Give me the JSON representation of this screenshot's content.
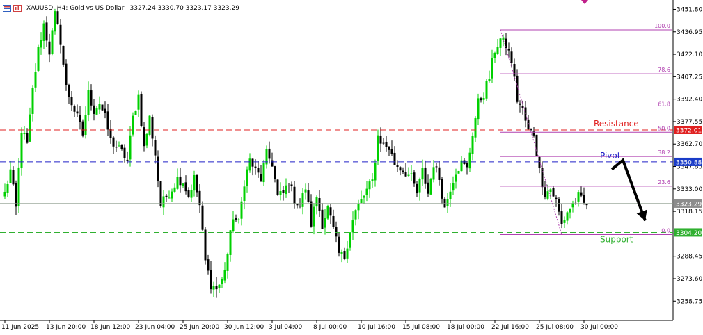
{
  "header": {
    "symbol_line": "XAUUSD, H4:  Gold vs US Dollar",
    "ohlc": "3327.24 3330.70 3323.17 3323.29",
    "icons": [
      "chart-list-icon",
      "chart-bars-icon"
    ]
  },
  "colors": {
    "bull": "#00d000",
    "bear": "#000000",
    "grid": "#ffffff",
    "axis": "#000000",
    "resistance": "#e02020",
    "pivot": "#2020c8",
    "support": "#30b030",
    "fib": "#b040b0",
    "current_line": "#8a9a8a",
    "current_tag": "#8c8c8c",
    "marker": "#c0208a"
  },
  "chart_data": {
    "type": "candlestick",
    "title": "XAUUSD, H4: Gold vs US Dollar",
    "ylim": [
      3246,
      3458
    ],
    "y_ticks": [
      "3451.80",
      "3436.95",
      "3422.10",
      "3407.25",
      "3392.40",
      "3377.55",
      "3362.70",
      "3347.85",
      "3333.00",
      "3318.15",
      "3303.30",
      "3288.45",
      "3273.60",
      "3258.75"
    ],
    "y_tick_values": [
      3451.8,
      3436.95,
      3422.1,
      3407.25,
      3392.4,
      3377.55,
      3362.7,
      3347.85,
      3333.0,
      3318.15,
      3303.3,
      3288.45,
      3273.6,
      3258.75
    ],
    "x_ticks": [
      "11 Jun 2025",
      "13 Jun 20:00",
      "18 Jun 12:00",
      "23 Jun 04:00",
      "25 Jun 20:00",
      "30 Jun 12:00",
      "3 Jul 04:00",
      "8 Jul 00:00",
      "10 Jul 16:00",
      "15 Jul 08:00",
      "18 Jul 00:00",
      "22 Jul 16:00",
      "25 Jul 08:00",
      "30 Jul 00:00"
    ],
    "x_tick_index": [
      0,
      16,
      32,
      48,
      64,
      80,
      96,
      112,
      128,
      144,
      160,
      176,
      192,
      208
    ],
    "levels": [
      {
        "name": "Resistance",
        "value": 3372.01,
        "label": "3372.01"
      },
      {
        "name": "Pivot",
        "value": 3350.88,
        "label": "3350.88"
      },
      {
        "name": "Support",
        "value": 3304.2,
        "label": "3304.20"
      }
    ],
    "current_price": {
      "value": 3323.29,
      "label": "3323.29"
    },
    "fibonacci": {
      "high": 3438.2,
      "low": 3302.8,
      "start_index": 178,
      "end_index": 200,
      "levels": [
        {
          "label": "100.0",
          "value": 3438.2
        },
        {
          "label": "78.6",
          "value": 3409.2
        },
        {
          "label": "61.8",
          "value": 3386.5
        },
        {
          "label": "50.0",
          "value": 3370.5
        },
        {
          "label": "38.2",
          "value": 3354.5
        },
        {
          "label": "23.6",
          "value": 3334.8
        },
        {
          "label": "0.0",
          "value": 3302.8
        }
      ]
    },
    "annotations": [
      {
        "text": "Resistance",
        "color": "resistance"
      },
      {
        "text": "Pivot",
        "color": "pivot"
      },
      {
        "text": "Support",
        "color": "support"
      }
    ],
    "arrow_path": [
      [
        218,
        3346
      ],
      [
        222,
        3352
      ],
      [
        230,
        3312
      ]
    ],
    "arrow_color": "#000000",
    "anchors": [
      [
        0,
        3330
      ],
      [
        2,
        3345
      ],
      [
        4,
        3320
      ],
      [
        6,
        3372
      ],
      [
        8,
        3362
      ],
      [
        10,
        3398
      ],
      [
        12,
        3425
      ],
      [
        14,
        3442
      ],
      [
        16,
        3424
      ],
      [
        18,
        3448
      ],
      [
        20,
        3431
      ],
      [
        22,
        3400
      ],
      [
        24,
        3390
      ],
      [
        26,
        3380
      ],
      [
        28,
        3369
      ],
      [
        30,
        3396
      ],
      [
        32,
        3385
      ],
      [
        34,
        3390
      ],
      [
        36,
        3380
      ],
      [
        38,
        3365
      ],
      [
        40,
        3361
      ],
      [
        42,
        3357
      ],
      [
        44,
        3352
      ],
      [
        46,
        3380
      ],
      [
        48,
        3395
      ],
      [
        50,
        3360
      ],
      [
        52,
        3380
      ],
      [
        54,
        3356
      ],
      [
        56,
        3322
      ],
      [
        58,
        3328
      ],
      [
        60,
        3333
      ],
      [
        62,
        3340
      ],
      [
        64,
        3338
      ],
      [
        66,
        3328
      ],
      [
        68,
        3340
      ],
      [
        70,
        3322
      ],
      [
        72,
        3285
      ],
      [
        74,
        3270
      ],
      [
        76,
        3267
      ],
      [
        78,
        3272
      ],
      [
        80,
        3290
      ],
      [
        82,
        3315
      ],
      [
        84,
        3310
      ],
      [
        86,
        3338
      ],
      [
        88,
        3352
      ],
      [
        90,
        3345
      ],
      [
        92,
        3340
      ],
      [
        94,
        3356
      ],
      [
        96,
        3350
      ],
      [
        98,
        3328
      ],
      [
        100,
        3330
      ],
      [
        102,
        3338
      ],
      [
        104,
        3326
      ],
      [
        106,
        3322
      ],
      [
        108,
        3334
      ],
      [
        110,
        3310
      ],
      [
        112,
        3328
      ],
      [
        114,
        3310
      ],
      [
        116,
        3320
      ],
      [
        118,
        3306
      ],
      [
        120,
        3290
      ],
      [
        122,
        3288
      ],
      [
        124,
        3306
      ],
      [
        126,
        3318
      ],
      [
        128,
        3325
      ],
      [
        130,
        3332
      ],
      [
        132,
        3338
      ],
      [
        134,
        3368
      ],
      [
        136,
        3362
      ],
      [
        138,
        3360
      ],
      [
        140,
        3350
      ],
      [
        142,
        3347
      ],
      [
        144,
        3344
      ],
      [
        146,
        3340
      ],
      [
        148,
        3330
      ],
      [
        150,
        3345
      ],
      [
        152,
        3330
      ],
      [
        154,
        3350
      ],
      [
        156,
        3340
      ],
      [
        158,
        3320
      ],
      [
        160,
        3334
      ],
      [
        162,
        3345
      ],
      [
        164,
        3350
      ],
      [
        166,
        3346
      ],
      [
        168,
        3370
      ],
      [
        170,
        3390
      ],
      [
        172,
        3396
      ],
      [
        174,
        3407
      ],
      [
        176,
        3425
      ],
      [
        178,
        3432
      ],
      [
        180,
        3428
      ],
      [
        182,
        3418
      ],
      [
        184,
        3392
      ],
      [
        186,
        3385
      ],
      [
        188,
        3371
      ],
      [
        190,
        3370
      ],
      [
        192,
        3345
      ],
      [
        194,
        3330
      ],
      [
        196,
        3333
      ],
      [
        198,
        3325
      ],
      [
        200,
        3309
      ],
      [
        202,
        3318
      ],
      [
        204,
        3323
      ],
      [
        206,
        3328
      ],
      [
        208,
        3323
      ]
    ],
    "marker": {
      "shape": "triangle-down",
      "index": 202
    }
  }
}
